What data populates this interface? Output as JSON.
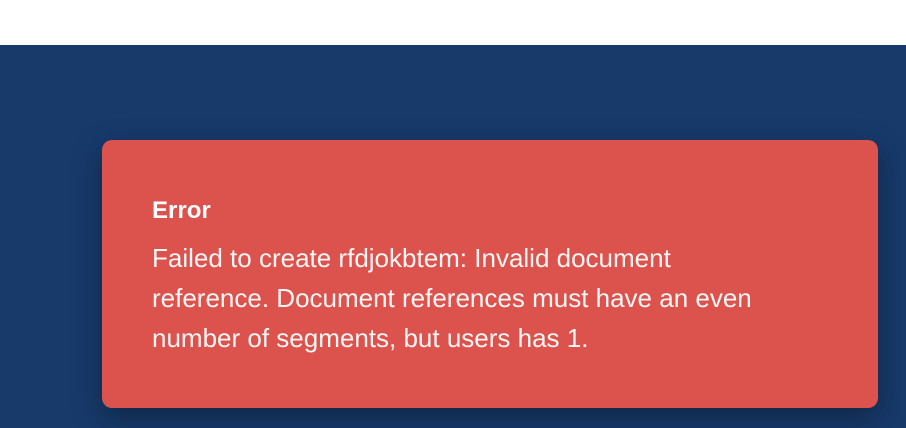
{
  "toast": {
    "title": "Error",
    "message": "Failed to create rfdjokbtem: Invalid document reference. Document references must have an even number of segments, but users has 1."
  },
  "colors": {
    "background": "#173a6b",
    "toast": "#dc524d",
    "text": "#ffffff"
  }
}
